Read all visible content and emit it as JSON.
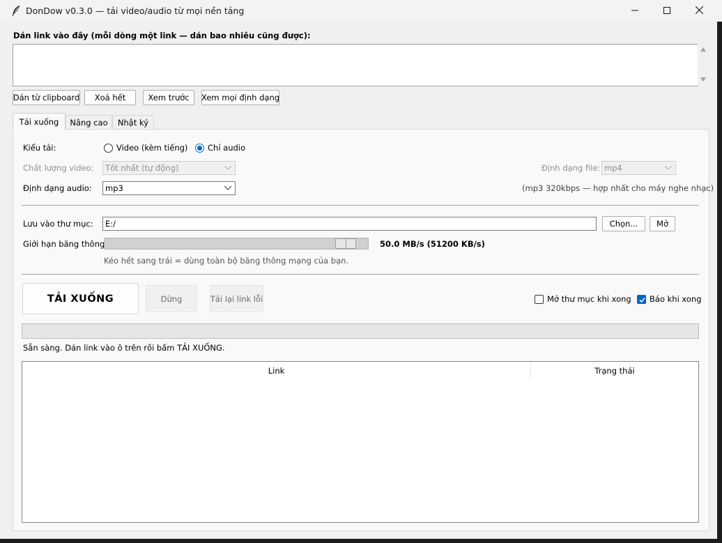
{
  "window": {
    "title": "DonDow v0.3.0 — tải video/audio từ mọi nền tảng"
  },
  "links": {
    "label": "Dán link vào đây (mỗi dòng một link — dán bao nhiêu cũng được):",
    "value": ""
  },
  "toolbar": {
    "paste_clipboard": "Dán từ clipboard",
    "clear_all": "Xoá hết",
    "preview": "Xem trước",
    "view_all_formats": "Xem mọi định dạng"
  },
  "tabs": [
    {
      "label": "Tải xuống",
      "active": true
    },
    {
      "label": "Nâng cao",
      "active": false
    },
    {
      "label": "Nhật ký",
      "active": false
    }
  ],
  "download": {
    "mode_label": "Kiểu tải:",
    "mode_options": [
      {
        "label": "Video (kèm tiếng)",
        "selected": false
      },
      {
        "label": "Chỉ audio",
        "selected": true
      }
    ],
    "video_quality_label": "Chất lượng video:",
    "video_quality_value": "Tốt nhất (tự động)",
    "file_format_label": "Định dạng file:",
    "file_format_value": "mp4",
    "audio_format_label": "Định dạng audio:",
    "audio_format_value": "mp3",
    "audio_hint": "(mp3 320kbps — hợp nhất cho máy nghe nhạc)",
    "save_dir_label": "Lưu vào thư mục:",
    "save_dir_value": "E:/",
    "choose_button": "Chọn...",
    "open_button": "Mở",
    "bandwidth_label": "Giới hạn băng thông:",
    "bandwidth_value_text": "50.0 MB/s (51200 KB/s)",
    "bandwidth_fraction": 0.95,
    "bandwidth_hint": "Kéo hết sang trái = dùng toàn bộ băng thông mạng của bạn.",
    "download_button": "TẢI XUỐNG",
    "stop_button": "Dừng",
    "retry_button": "Tải lại link lỗi",
    "open_folder_when_done_label": "Mở thư mục khi xong",
    "open_folder_when_done_checked": false,
    "notify_when_done_label": "Báo khi xong",
    "notify_when_done_checked": true,
    "progress_fraction": 0,
    "status_text": "Sẵn sàng. Dán link vào ô trên rồi bấm TẢI XUỐNG.",
    "table_columns": [
      "Link",
      "Trạng thái"
    ],
    "table_rows": []
  },
  "colors": {
    "accent": "#0067c0",
    "window_bg": "#f0f0f0",
    "panel_bg": "#f9f9f9"
  },
  "icons": {
    "app": "feather-icon",
    "minimize": "minimize-icon",
    "maximize": "maximize-icon",
    "close": "close-icon"
  }
}
